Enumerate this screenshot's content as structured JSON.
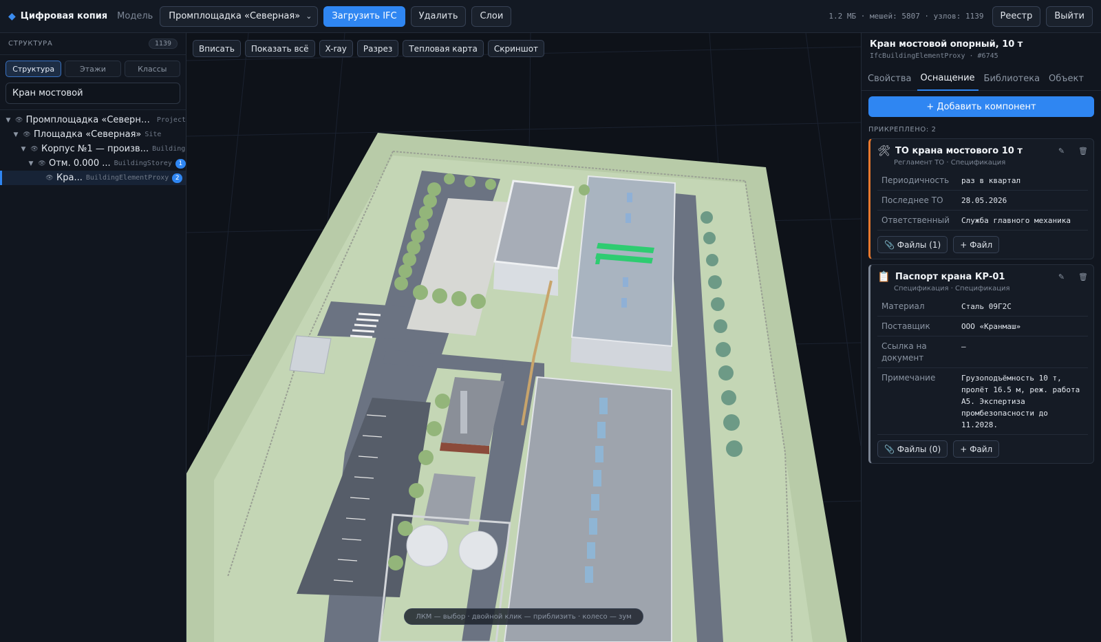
{
  "topbar": {
    "brand": "Цифровая копия",
    "model_label": "Модель",
    "model_selected": "Промплощадка «Северная»",
    "upload_label": "Загрузить IFC",
    "delete_label": "Удалить",
    "layers_label": "Слои",
    "stats": "1.2 МБ · мешей: 5807 · узлов: 1139",
    "registry_label": "Реестр",
    "logout_label": "Выйти"
  },
  "sidebar": {
    "title": "СТРУКТУРА",
    "count": "1139",
    "tabs": [
      "Структура",
      "Этажи",
      "Классы"
    ],
    "search_value": "Кран мостовой",
    "tree": [
      {
        "label": "Промплощадка «Северна...",
        "type": "Project",
        "badge": ""
      },
      {
        "label": "Площадка «Северная»",
        "type": "Site",
        "badge": ""
      },
      {
        "label": "Корпус №1 — произв...",
        "type": "Building",
        "badge": ""
      },
      {
        "label": "Отм. 0.000 ...",
        "type": "BuildingStorey",
        "badge": "1"
      },
      {
        "label": "Кра...",
        "type": "BuildingElementProxy",
        "badge": "2"
      }
    ]
  },
  "viewport": {
    "tools": [
      "Вписать",
      "Показать всё",
      "X-ray",
      "Разрез",
      "Тепловая карта",
      "Скриншот"
    ],
    "hint": "ЛКМ — выбор · двойной клик — приблизить · колесо — зум"
  },
  "panel": {
    "title": "Кран мостовой опорный, 10 т",
    "subtitle": "IfcBuildingElementProxy · #6745",
    "tabs": [
      "Свойства",
      "Оснащение",
      "Библиотека",
      "Объект"
    ],
    "add_label": "+ Добавить компонент",
    "attached_label": "ПРИКРЕПЛЕНО: 2",
    "cards": [
      {
        "icon": "🛠",
        "title": "ТО крана мостового 10 т",
        "subtitle": "Регламент ТО · Спецификация",
        "props": [
          {
            "k": "Периодичность",
            "v": "раз в квартал"
          },
          {
            "k": "Последнее ТО",
            "v": "28.05.2026"
          },
          {
            "k": "Ответственный",
            "v": "Служба главного механика"
          }
        ],
        "files_label": "📎 Файлы (1)",
        "add_file_label": "+ Файл"
      },
      {
        "icon": "📋",
        "title": "Паспорт крана КР-01",
        "subtitle": "Спецификация · Спецификация",
        "props": [
          {
            "k": "Материал",
            "v": "Сталь 09Г2С"
          },
          {
            "k": "Поставщик",
            "v": "ООО «Кранмаш»"
          },
          {
            "k": "Ссылка на документ",
            "v": "—"
          },
          {
            "k": "Примечание",
            "v": "Грузоподъёмность 10 т, пролёт 16.5 м, реж. работа А5. Экспертиза промбезопасности до 11.2028."
          }
        ],
        "files_label": "📎 Файлы (0)",
        "add_file_label": "+ Файл"
      }
    ]
  },
  "colors": {
    "accent": "#2f86f2",
    "card_orange": "#e8792e",
    "highlight_green": "#2ecc71",
    "ground": "#b8cba8"
  }
}
